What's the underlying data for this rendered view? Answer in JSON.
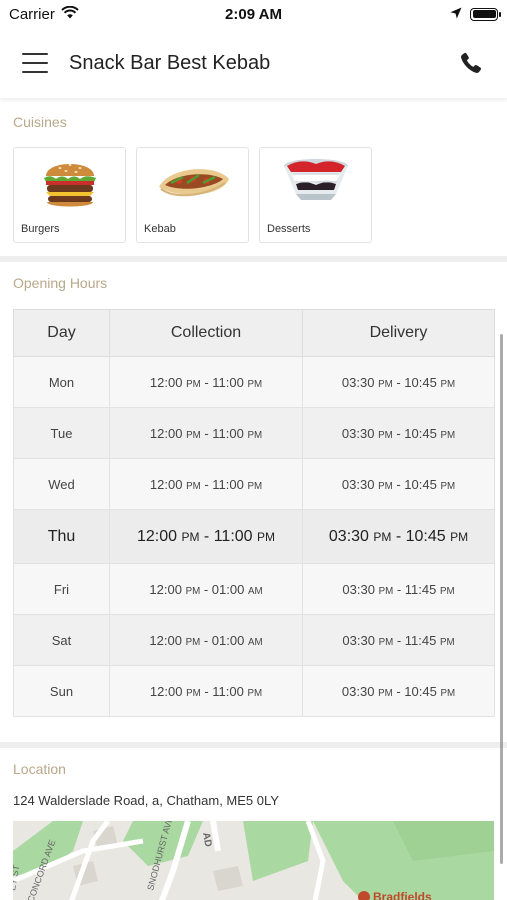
{
  "status_bar": {
    "carrier": "Carrier",
    "time": "2:09 AM"
  },
  "header": {
    "title": "Snack Bar Best Kebab"
  },
  "cuisines": {
    "title": "Cuisines",
    "items": [
      {
        "label": "Burgers",
        "icon": "burger-icon"
      },
      {
        "label": "Kebab",
        "icon": "kebab-icon"
      },
      {
        "label": "Desserts",
        "icon": "dessert-icon"
      }
    ]
  },
  "opening_hours": {
    "title": "Opening Hours",
    "columns": [
      "Day",
      "Collection",
      "Delivery"
    ],
    "rows": [
      {
        "day": "Mon",
        "collection": [
          "12:00",
          "PM",
          "11:00",
          "PM"
        ],
        "delivery": [
          "03:30",
          "PM",
          "10:45",
          "PM"
        ],
        "today": false
      },
      {
        "day": "Tue",
        "collection": [
          "12:00",
          "PM",
          "11:00",
          "PM"
        ],
        "delivery": [
          "03:30",
          "PM",
          "10:45",
          "PM"
        ],
        "today": false
      },
      {
        "day": "Wed",
        "collection": [
          "12:00",
          "PM",
          "11:00",
          "PM"
        ],
        "delivery": [
          "03:30",
          "PM",
          "10:45",
          "PM"
        ],
        "today": false
      },
      {
        "day": "Thu",
        "collection": [
          "12:00",
          "PM",
          "11:00",
          "PM"
        ],
        "delivery": [
          "03:30",
          "PM",
          "10:45",
          "PM"
        ],
        "today": true
      },
      {
        "day": "Fri",
        "collection": [
          "12:00",
          "PM",
          "01:00",
          "AM"
        ],
        "delivery": [
          "03:30",
          "PM",
          "11:45",
          "PM"
        ],
        "today": false
      },
      {
        "day": "Sat",
        "collection": [
          "12:00",
          "PM",
          "01:00",
          "AM"
        ],
        "delivery": [
          "03:30",
          "PM",
          "11:45",
          "PM"
        ],
        "today": false
      },
      {
        "day": "Sun",
        "collection": [
          "12:00",
          "PM",
          "11:00",
          "PM"
        ],
        "delivery": [
          "03:30",
          "PM",
          "10:45",
          "PM"
        ],
        "today": false
      }
    ]
  },
  "location": {
    "title": "Location",
    "address": "124 Walderslade Road, a, Chatham, ME5 0LY",
    "map": {
      "street_labels": [
        "CONCORD AVE",
        "SNODHURST AVE",
        "AD",
        "EY ST"
      ],
      "place_label": "Bradfields"
    }
  },
  "colors": {
    "section_title": "#b8a88a",
    "map_green": "#a9d8a0",
    "map_place": "#c0492b"
  }
}
